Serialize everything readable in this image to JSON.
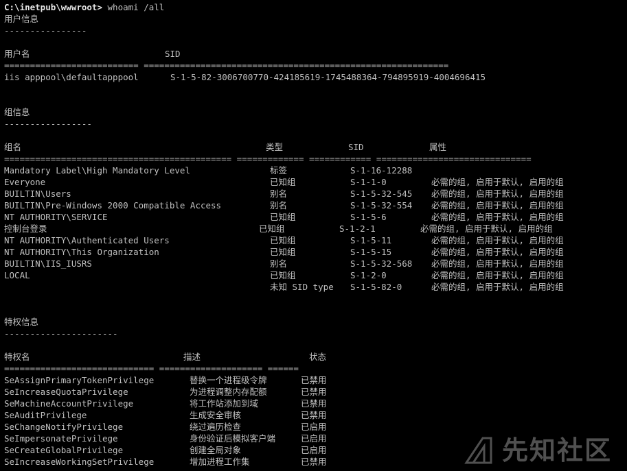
{
  "prompt": "C:\\inetpub\\wwwroot>",
  "command": " whoami /all",
  "user_section": {
    "title": "用户信息",
    "underline": "----------------",
    "headers": [
      "用户名",
      "SID"
    ],
    "separator": "========================== ===========================================================",
    "rows": [
      {
        "name": "iis apppool\\defaultapppool",
        "sid": "S-1-5-82-3006700770-424185619-1745488364-794895919-4004696415"
      }
    ]
  },
  "group_section": {
    "title": "组信息",
    "underline": "-----------------",
    "headers": [
      "组名",
      "类型",
      "SID",
      "属性"
    ],
    "separator": "============================================ ============= ============ ==============================",
    "rows": [
      {
        "name": "Mandatory Label\\High Mandatory Level",
        "type": "标签",
        "sid": "S-1-16-12288",
        "attr": ""
      },
      {
        "name": "Everyone",
        "type": "已知组",
        "sid": "S-1-1-0",
        "attr": "必需的组, 启用于默认, 启用的组"
      },
      {
        "name": "BUILTIN\\Users",
        "type": "别名",
        "sid": "S-1-5-32-545",
        "attr": "必需的组, 启用于默认, 启用的组"
      },
      {
        "name": "BUILTIN\\Pre-Windows 2000 Compatible Access",
        "type": "别名",
        "sid": "S-1-5-32-554",
        "attr": "必需的组, 启用于默认, 启用的组"
      },
      {
        "name": "NT AUTHORITY\\SERVICE",
        "type": "已知组",
        "sid": "S-1-5-6",
        "attr": "必需的组, 启用于默认, 启用的组"
      },
      {
        "name": "控制台登录",
        "type": "已知组",
        "sid": "S-1-2-1",
        "attr": "必需的组, 启用于默认, 启用的组"
      },
      {
        "name": "NT AUTHORITY\\Authenticated Users",
        "type": "已知组",
        "sid": "S-1-5-11",
        "attr": "必需的组, 启用于默认, 启用的组"
      },
      {
        "name": "NT AUTHORITY\\This Organization",
        "type": "已知组",
        "sid": "S-1-5-15",
        "attr": "必需的组, 启用于默认, 启用的组"
      },
      {
        "name": "BUILTIN\\IIS_IUSRS",
        "type": "别名",
        "sid": "S-1-5-32-568",
        "attr": "必需的组, 启用于默认, 启用的组"
      },
      {
        "name": "LOCAL",
        "type": "已知组",
        "sid": "S-1-2-0",
        "attr": "必需的组, 启用于默认, 启用的组"
      },
      {
        "name": "",
        "type": "未知 SID type",
        "sid": "S-1-5-82-0",
        "attr": "必需的组, 启用于默认, 启用的组"
      }
    ]
  },
  "priv_section": {
    "title": "特权信息",
    "underline": "----------------------",
    "headers": [
      "特权名",
      "描述",
      "状态"
    ],
    "separator": "============================= ==================== ======",
    "rows": [
      {
        "name": "SeAssignPrimaryTokenPrivilege",
        "desc": "替换一个进程级令牌",
        "state": "已禁用"
      },
      {
        "name": "SeIncreaseQuotaPrivilege",
        "desc": "为进程调整内存配额",
        "state": "已禁用"
      },
      {
        "name": "SeMachineAccountPrivilege",
        "desc": "将工作站添加到域",
        "state": "已禁用"
      },
      {
        "name": "SeAuditPrivilege",
        "desc": "生成安全审核",
        "state": "已禁用"
      },
      {
        "name": "SeChangeNotifyPrivilege",
        "desc": "绕过遍历检查",
        "state": "已启用"
      },
      {
        "name": "SeImpersonatePrivilege",
        "desc": "身份验证后模拟客户端",
        "state": "已启用"
      },
      {
        "name": "SeCreateGlobalPrivilege",
        "desc": "创建全局对象",
        "state": "已启用"
      },
      {
        "name": "SeIncreaseWorkingSetPrivilege",
        "desc": "增加进程工作集",
        "state": "已禁用"
      }
    ]
  },
  "watermark": {
    "text": "先知社区",
    "icon": "xianzhi-logo-icon"
  }
}
